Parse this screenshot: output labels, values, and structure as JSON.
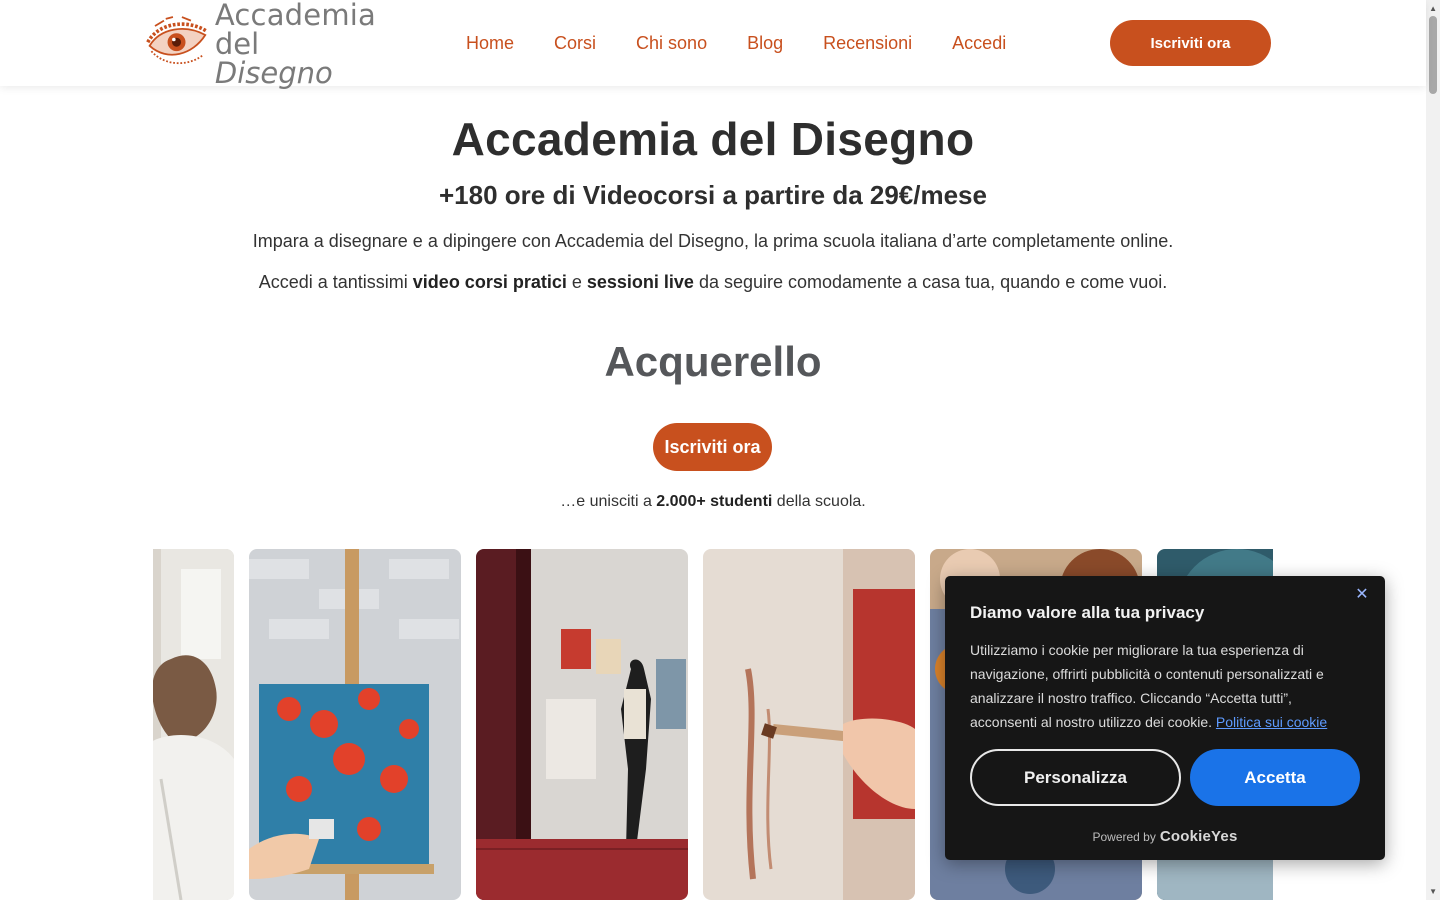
{
  "header": {
    "logo": {
      "line1": "Accademia",
      "line2_prefix": "del ",
      "line2_italic": "Disegno"
    },
    "nav": [
      {
        "label": "Home"
      },
      {
        "label": "Corsi"
      },
      {
        "label": "Chi sono"
      },
      {
        "label": "Blog"
      },
      {
        "label": "Recensioni"
      },
      {
        "label": "Accedi"
      }
    ],
    "cta_label": "Iscriviti ora"
  },
  "hero": {
    "title": "Accademia del Disegno",
    "subtitle": "+180 ore di Videocorsi a partire da 29€/mese",
    "paragraph1": "Impara a disegnare e a dipingere con Accademia del Disegno, la prima scuola italiana d’arte completamente online.",
    "paragraph2": {
      "p1": "Accedi a tantissimi ",
      "b1": "video corsi pratici",
      "p2": " e ",
      "b2": "sessioni live",
      "p3": " da seguire comodamente a casa tua, quando e come vuoi."
    }
  },
  "section": {
    "title": "Acquerello",
    "cta_label": "Iscriviti ora",
    "students": {
      "prefix": "…e unisciti a ",
      "bold": "2.000+ studenti",
      "suffix": " della scuola."
    }
  },
  "cookie": {
    "title": "Diamo valore alla tua privacy",
    "text": "Utilizziamo i cookie per migliorare la tua esperienza di navigazione, offrirti pubblicità o contenuti personalizzati e analizzare il nostro traffico. Cliccando “Accetta tutti”, acconsenti al nostro utilizzo dei cookie. ",
    "link": "Politica sui cookie",
    "customize_label": "Personalizza",
    "accept_label": "Accetta",
    "powered_by": "Powered by",
    "brand": "CookieYes",
    "close_icon": "close-icon"
  },
  "colors": {
    "accent": "#c8501e",
    "accept_blue": "#1a73e8",
    "banner_bg": "#161616"
  }
}
